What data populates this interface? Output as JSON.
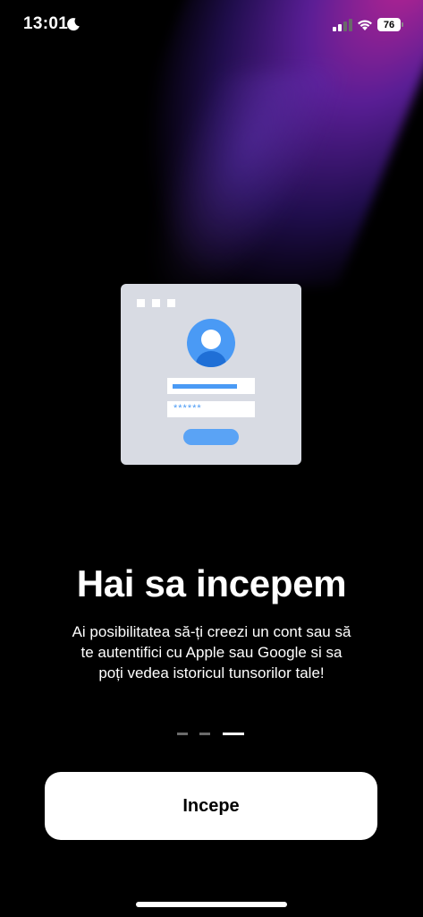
{
  "status_bar": {
    "time": "13:01",
    "moon_icon": "moon-icon",
    "signal_icon": "cellular-signal-icon",
    "wifi_icon": "wifi-icon",
    "battery_level": "76"
  },
  "illustration": {
    "icon": "login-form-illustration",
    "password_mask": "******",
    "colors": {
      "card": "#d8dbe3",
      "accent": "#4a9af5",
      "dark_accent": "#1f6fd6"
    }
  },
  "onboarding": {
    "title": "Hai sa incepem",
    "description": "Ai posibilitatea să-ți creezi un cont sau să te autentifici cu Apple sau Google si sa poți vedea istoricul tunsorilor tale!",
    "page_indicator": {
      "total": 3,
      "current": 3
    },
    "start_button_label": "Incepe"
  },
  "colors": {
    "background": "#000000",
    "glow": "#7a2bd0",
    "button_bg": "#ffffff"
  }
}
